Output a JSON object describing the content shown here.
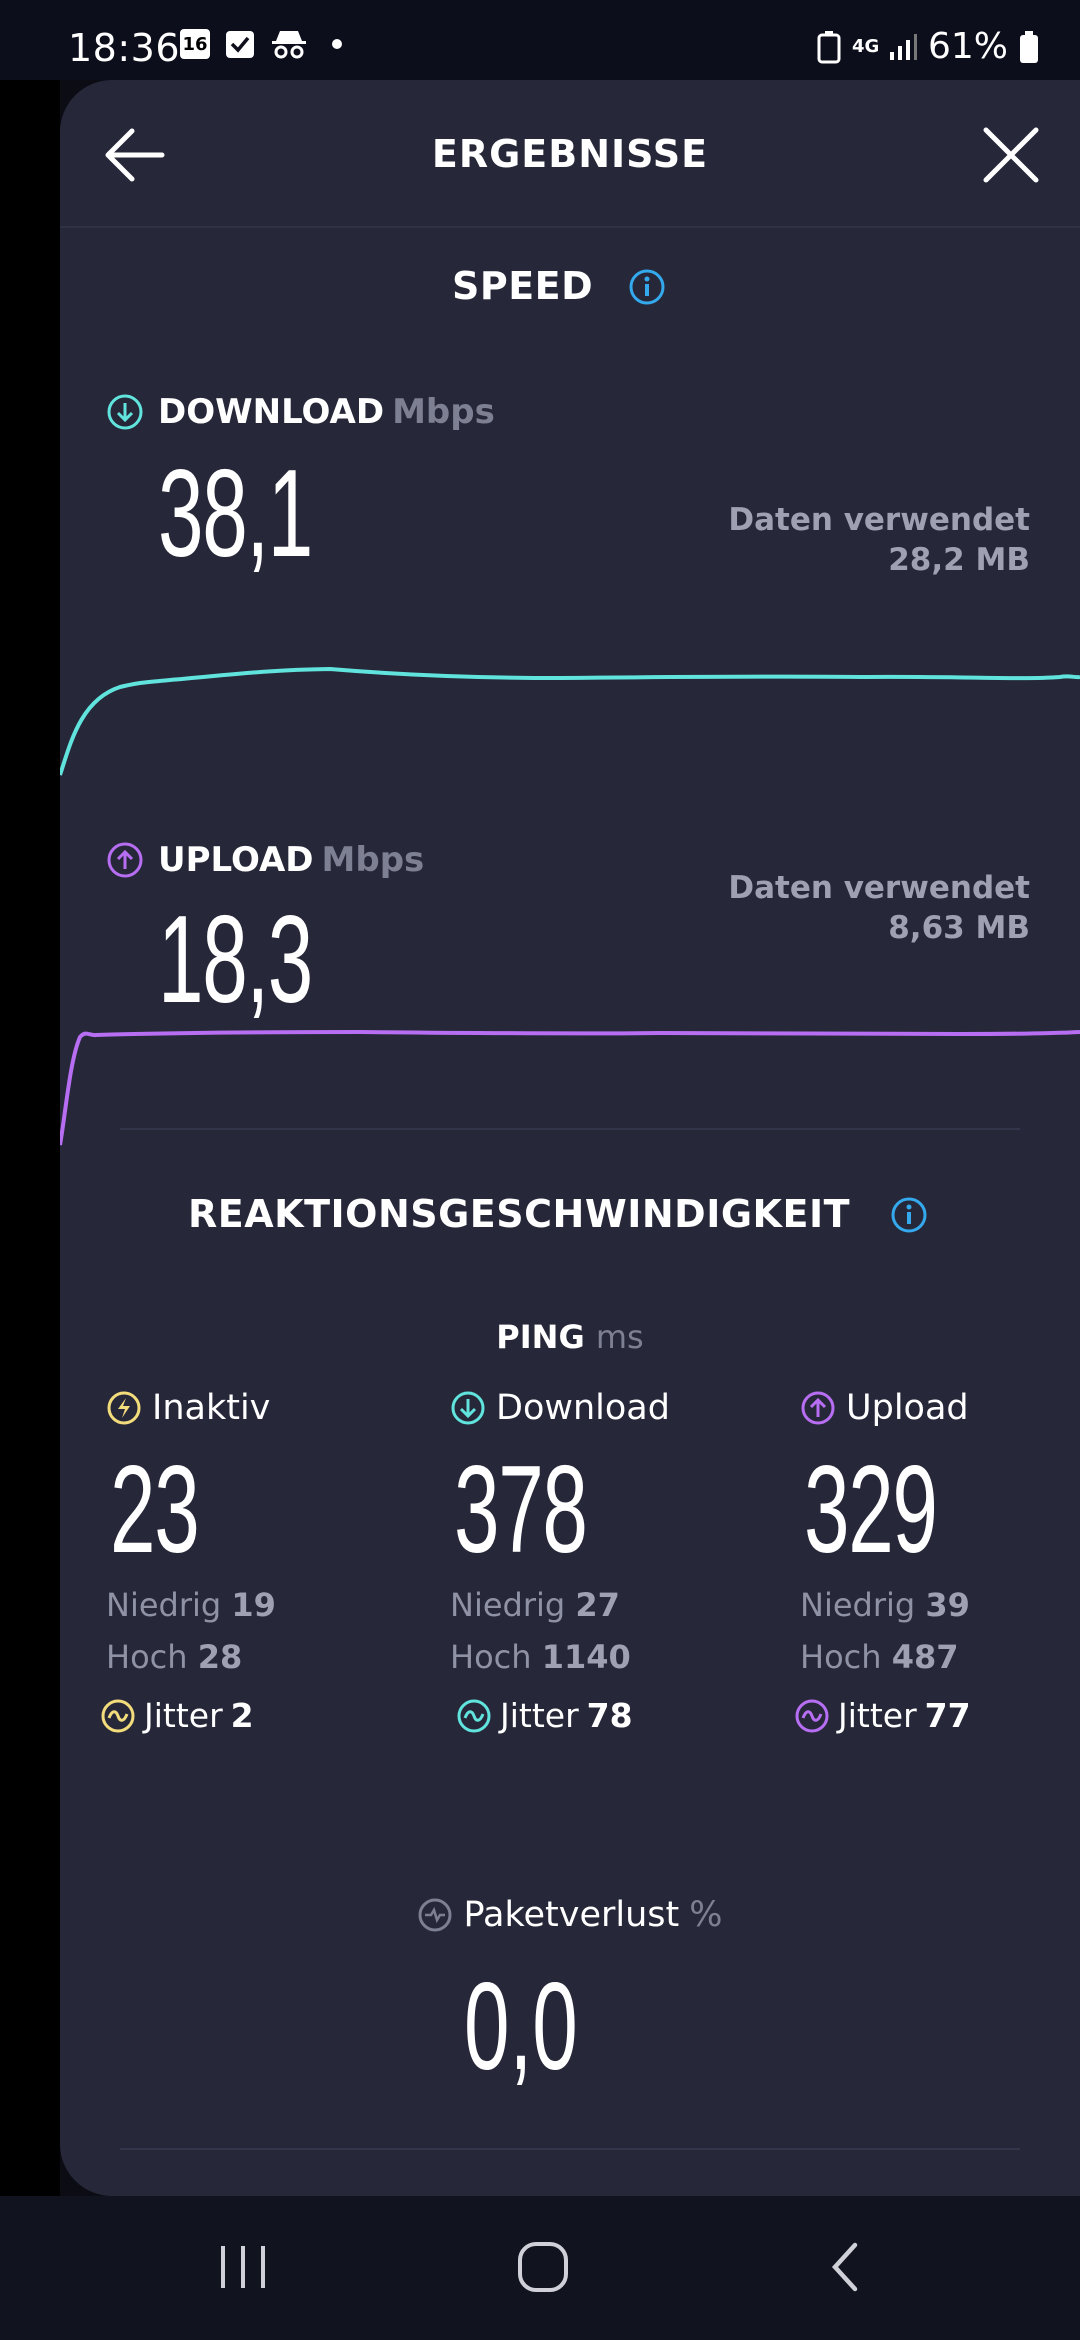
{
  "status_bar": {
    "time": "18:36",
    "calendar_day": "16",
    "network": "4G",
    "battery": "61%"
  },
  "header": {
    "title": "ERGEBNISSE"
  },
  "speed": {
    "title": "SPEED",
    "download": {
      "label": "DOWNLOAD",
      "unit": "Mbps",
      "value": "38,1",
      "data_used_label": "Daten verwendet",
      "data_used_value": "28,2 MB",
      "color": "#61e4dd"
    },
    "upload": {
      "label": "UPLOAD",
      "unit": "Mbps",
      "value": "18,3",
      "data_used_label": "Daten verwendet",
      "data_used_value": "8,63 MB",
      "color": "#b86ef2"
    }
  },
  "responsiveness": {
    "title": "REAKTIONSGESCHWINDIGKEIT",
    "ping_label": "PING",
    "ping_unit": "ms",
    "columns": [
      {
        "label": "Inaktiv",
        "value": "23",
        "low_label": "Niedrig",
        "low": "19",
        "high_label": "Hoch",
        "high": "28",
        "jitter_label": "Jitter",
        "jitter": "2",
        "color": "#f3dc7c"
      },
      {
        "label": "Download",
        "value": "378",
        "low_label": "Niedrig",
        "low": "27",
        "high_label": "Hoch",
        "high": "1140",
        "jitter_label": "Jitter",
        "jitter": "78",
        "color": "#61e4dd"
      },
      {
        "label": "Upload",
        "value": "329",
        "low_label": "Niedrig",
        "low": "39",
        "high_label": "Hoch",
        "high": "487",
        "jitter_label": "Jitter",
        "jitter": "77",
        "color": "#b86ef2"
      }
    ],
    "packet_loss": {
      "label": "Paketverlust",
      "unit": "%",
      "value": "0,0"
    }
  },
  "info_color": "#35a9ee"
}
